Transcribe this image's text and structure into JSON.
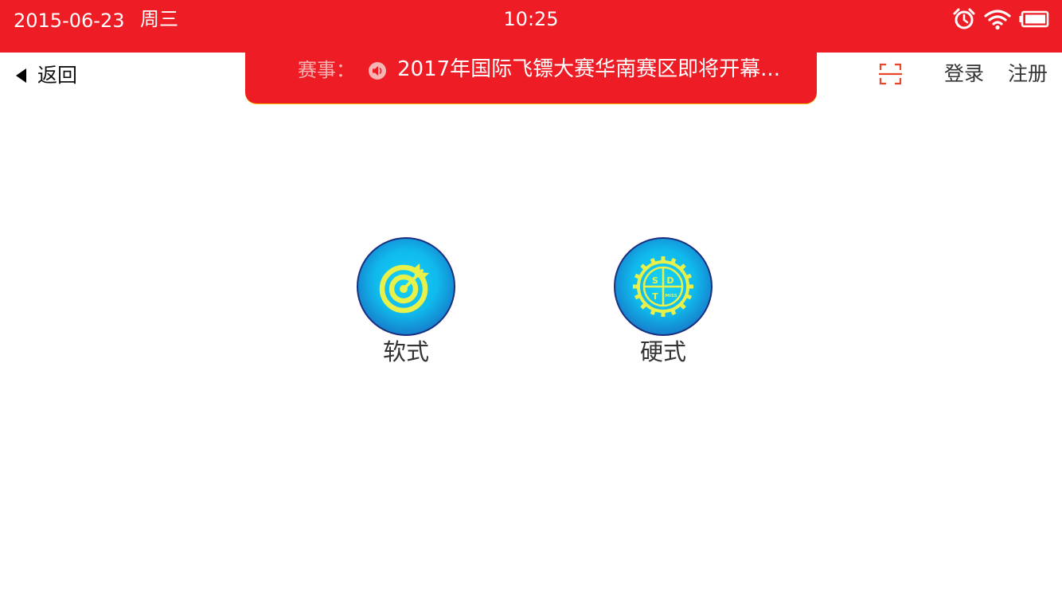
{
  "status_bar": {
    "date": "2015-06-23",
    "weekday": "周三",
    "time": "10:25",
    "icons": [
      "alarm-icon",
      "wifi-icon",
      "battery-icon"
    ]
  },
  "nav": {
    "back_label": "返回",
    "scan_icon": "scan-icon",
    "login_label": "登录",
    "register_label": "注册"
  },
  "banner": {
    "label": "赛事：",
    "icon": "speaker-icon",
    "text": "2017年国际飞镖大赛华南赛区即将开幕..."
  },
  "modes": [
    {
      "label": "软式",
      "icon": "dartboard-target-icon"
    },
    {
      "label": "硬式",
      "icon": "sdt-gear-badge-icon",
      "badge_letters": [
        "S",
        "D",
        "T",
        "MISS"
      ]
    }
  ],
  "colors": {
    "brand_red": "#ee1c25",
    "icon_blue": "#10b9ec",
    "icon_yellow": "#e8f04a",
    "text_dark": "#333333"
  }
}
